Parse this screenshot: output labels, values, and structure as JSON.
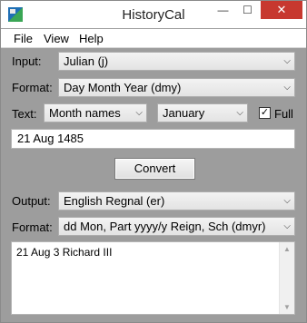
{
  "window": {
    "title": "HistoryCal",
    "min_glyph": "—",
    "max_glyph": "☐",
    "close_glyph": "✕"
  },
  "menu": {
    "file": "File",
    "view": "View",
    "help": "Help"
  },
  "input": {
    "label": "Input:",
    "value": "Julian  (j)"
  },
  "input_format": {
    "label": "Format:",
    "value": "Day Month Year  (dmy)"
  },
  "text_options": {
    "label": "Text:",
    "names_value": "Month names",
    "month_value": "January",
    "full_label": "Full",
    "full_checked": "✓"
  },
  "date_input": {
    "value": "21 Aug 1485"
  },
  "convert": {
    "label": "Convert"
  },
  "output": {
    "label": "Output:",
    "value": "English Regnal  (er)"
  },
  "output_format": {
    "label": "Format:",
    "value": "dd Mon, Part yyyy/y Reign, Sch  (dmyr)"
  },
  "result": {
    "text": "21 Aug 3 Richard III"
  },
  "icons": {
    "chevron": "⌵",
    "scroll_up": "▲",
    "scroll_down": "▼"
  }
}
